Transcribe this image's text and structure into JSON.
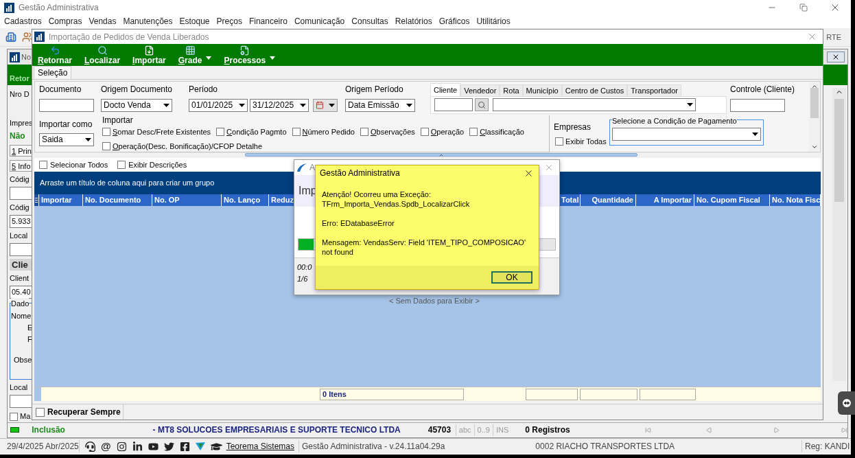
{
  "app": {
    "title": "Gestão Administrativa",
    "menu": [
      "Cadastros",
      "Compras",
      "Vendas",
      "Manutenções",
      "Estoque",
      "Preços",
      "Financeiro",
      "Comunicação",
      "Consultas",
      "Relatórios",
      "Gráficos",
      "Utilitários"
    ],
    "toolbar_right_text": "RTE"
  },
  "background_form": {
    "title": "No",
    "toolbar_button": "Retor",
    "labels_top": [
      "Nro D",
      "Impres"
    ],
    "status": "Não",
    "tabs": [
      "1 Prin",
      "5 Info"
    ],
    "items": [
      {
        "kind": "label",
        "text": "Códig"
      },
      {
        "kind": "field"
      },
      {
        "kind": "label",
        "text": "Códig"
      },
      {
        "kind": "field",
        "value": "5.933"
      },
      {
        "kind": "label",
        "text": "Local"
      },
      {
        "kind": "field"
      },
      {
        "kind": "heading",
        "text": "Clie"
      },
      {
        "kind": "label",
        "text": "Client"
      },
      {
        "kind": "field",
        "value": "05.40"
      },
      {
        "kind": "group",
        "title": "Dado",
        "labels": [
          "Nome",
          "E",
          "F",
          "Obse"
        ]
      },
      {
        "kind": "label",
        "text": "Local"
      },
      {
        "kind": "field"
      },
      {
        "kind": "checkbox",
        "text": "Ma",
        "checked": false
      }
    ],
    "status_bar": {
      "mode": "Inclusão",
      "company": "- MT8 SOLUCOES EMPRESARIAIS E SUPORTE TECNICO LTDA",
      "code": "45703",
      "indicators": [
        "abc",
        "0..9",
        "INS"
      ],
      "records": "0 Registros"
    }
  },
  "dialog": {
    "title": "Importação de Pedidos de Venda Liberados",
    "toolbar": [
      {
        "label": "Retornar",
        "kind": "back",
        "dropdown": false
      },
      {
        "label": "Localizar",
        "kind": "search",
        "dropdown": false
      },
      {
        "label": "Importar",
        "kind": "import",
        "dropdown": false
      },
      {
        "label": "Grade",
        "kind": "grid",
        "dropdown": true
      },
      {
        "label": "Processos",
        "kind": "process",
        "dropdown": true
      }
    ],
    "tab": "Seleção",
    "filters": {
      "documento": {
        "label": "Documento"
      },
      "origem_documento": {
        "label": "Origem Documento",
        "value": "Docto Venda"
      },
      "periodo": {
        "label": "Período",
        "from": "01/01/2025",
        "to": "31/12/2025"
      },
      "origem_periodo": {
        "label": "Origem Período",
        "value": "Data Emissão"
      },
      "entity_tabs": [
        {
          "label": "Cliente",
          "selected": true
        },
        {
          "label": "Vendedor",
          "selected": false
        },
        {
          "label": "Rota",
          "selected": false
        },
        {
          "label": "Município",
          "selected": false
        },
        {
          "label": "Centro de Custos",
          "selected": false
        },
        {
          "label": "Transportador",
          "selected": false
        }
      ],
      "controle": {
        "label": "Controle (Cliente)"
      },
      "importar_como": {
        "label": "Importar como",
        "value": "Saida"
      },
      "importar": {
        "label": "Importar",
        "options": [
          {
            "label": "Somar Desc/Frete Existentes",
            "checked": false
          },
          {
            "label": "Condição Pagmto",
            "checked": false
          },
          {
            "label": "Número Pedido",
            "checked": false
          },
          {
            "label": "Observações",
            "checked": false
          },
          {
            "label": "Operação",
            "checked": false
          },
          {
            "label": "Classificação",
            "checked": false
          },
          {
            "label": "Operação(Desc. Bonificação)/CFOP Detalhe",
            "checked": false
          }
        ]
      },
      "empresas": {
        "label": "Empresas",
        "option": {
          "label": "Exibir Todas",
          "checked": false
        }
      },
      "condicao": {
        "label": "Selecione a Condição de Pagamento"
      }
    },
    "list_options": [
      {
        "label": "Selecionar Todos",
        "checked": false
      },
      {
        "label": "Exibir Descrições",
        "checked": false
      }
    ],
    "grid": {
      "group_hint": "Arraste um título de coluna aqui para criar um grupo",
      "columns": [
        "Importar",
        "No. Documento",
        "No. OP",
        "No. Lanço",
        "Reduz",
        "Total",
        "Quantidade",
        "A Importar",
        "No. Cupom Fiscal",
        "No. Nota Fisc"
      ],
      "empty_text": "< Sem Dados para Exibir >",
      "footer": "0 Itens"
    },
    "recuperar": {
      "label": "Recuperar Sempre",
      "checked": false
    }
  },
  "progress": {
    "title": "A",
    "heading": "Imp",
    "level": 0.06,
    "lines": [
      "00:0",
      "1/6"
    ]
  },
  "error": {
    "title": "Gestão Administrativa",
    "messages": [
      "Atenção! Ocorreu uma Exceção: TFrm_Importa_Vendas.Spdb_LocalizarClick",
      "Erro: EDatabaseError",
      "Mensagem: VendasServ: Field 'ITEM_TIPO_COMPOSICAO' not found"
    ],
    "button": "OK"
  },
  "status_bar": {
    "date": "29/4/2025 Abr/2025",
    "at": "@",
    "link": "Teorema Sistemas",
    "version": "Gestão Administrativa - v.24.11a04.29a",
    "company": "0002 RIACHO TRANSPORTES LTDA",
    "reg": "Reg: KANDI"
  }
}
